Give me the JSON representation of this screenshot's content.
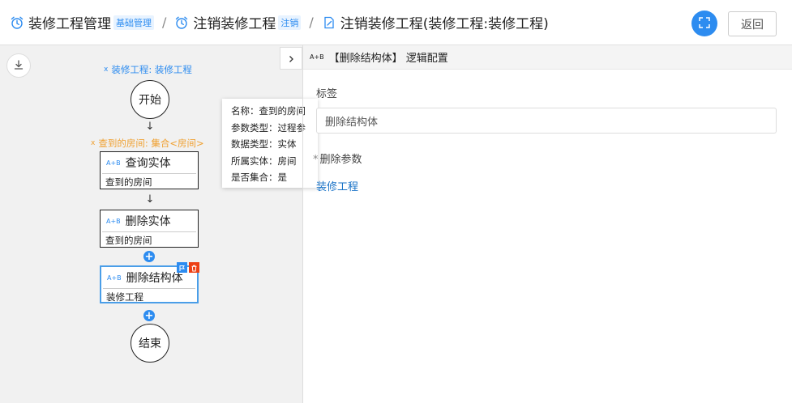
{
  "header": {
    "breadcrumbs": [
      {
        "label": "装修工程管理",
        "tag": "基础管理",
        "icon": "alarm-clock-icon"
      },
      {
        "label": "注销装修工程",
        "tag": "注销",
        "icon": "alarm-clock-icon"
      },
      {
        "label": "注销装修工程(装修工程:装修工程)",
        "icon": "edit-document-icon"
      }
    ],
    "separator": "/",
    "fullscreen_icon": "fullscreen-icon",
    "back_label": "返回"
  },
  "canvas": {
    "download_icon": "download-icon",
    "input_param": "装修工程: 装修工程",
    "start_label": "开始",
    "query_result_param": "查到的房间: 集合<房间>",
    "nodes": [
      {
        "badge": "A+B",
        "title": "查询实体",
        "sub": "查到的房间"
      },
      {
        "badge": "A+B",
        "title": "删除实体",
        "sub": "查到的房间"
      },
      {
        "badge": "A+B",
        "title": "删除结构体",
        "sub": "装修工程"
      }
    ],
    "end_label": "结束",
    "arrow": "↓",
    "plus": "+"
  },
  "tooltip": {
    "lines": [
      "名称：查到的房间",
      "参数类型：过程参",
      "数据类型：实体",
      "所属实体：房间",
      "是否集合：是"
    ]
  },
  "panel": {
    "collapse_icon": "chevron-right-icon",
    "badge": "A+B",
    "title": "【删除结构体】 逻辑配置",
    "label_field": "标签",
    "label_value": "删除结构体",
    "required_mark": "*",
    "delete_param_label": "删除参数",
    "delete_param_value": "装修工程"
  },
  "colors": {
    "accent": "#2d8cf0",
    "param_blue": "#2d8cf0",
    "param_orange": "#f0a030",
    "danger": "#ed4014"
  }
}
